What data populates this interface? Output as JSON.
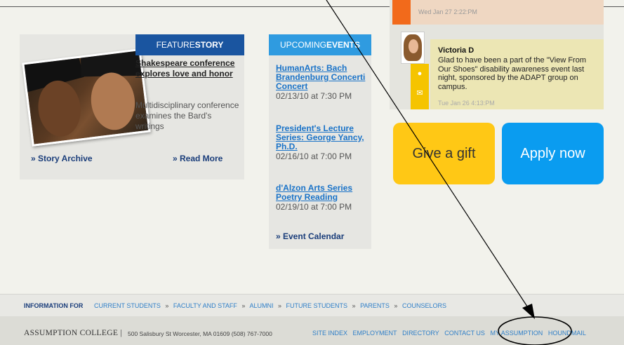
{
  "feature": {
    "head_light": "FEATURE",
    "head_bold": "STORY",
    "title": "Shakespeare conference explores love and honor",
    "description": "Multidisciplinary conference examines the Bard's writings",
    "story_archive": "» Story Archive",
    "read_more": "» Read More"
  },
  "events": {
    "head_light": "UPCOMING",
    "head_bold": "EVENTS",
    "items": [
      {
        "title": "HumanArts: Bach Brandenburg Concerti Concert",
        "date": "02/13/10 at 7:30 PM"
      },
      {
        "title": "President's Lecture Series: George Yancy, Ph.D.",
        "date": "02/16/10 at 7:00 PM"
      },
      {
        "title": "d'Alzon Arts Series Poetry Reading",
        "date": "02/19/10 at 7:00 PM"
      }
    ],
    "calendar_link": "» Event Calendar"
  },
  "feed": {
    "post1_time": "Wed Jan 27 2:22:PM",
    "post2": {
      "name": "Victoria D",
      "text": "Glad to have been a part of the \"View From Our Shoes\" disability awareness event last night, sponsored by the ADAPT group on campus.",
      "time": "Tue Jan 26 4:13:PM"
    }
  },
  "buttons": {
    "gift": "Give a gift",
    "apply": "Apply now"
  },
  "info_bar": {
    "label": "INFORMATION FOR",
    "links": [
      "CURRENT STUDENTS",
      "FACULTY AND STAFF",
      "ALUMNI",
      "FUTURE STUDENTS",
      "PARENTS",
      "COUNSELORS"
    ],
    "separator": "»"
  },
  "bottom_bar": {
    "college": "ASSUMPTION COLLEGE |",
    "address": "500 Salisbury St Worcester, MA 01609 (508) 767-7000",
    "links": [
      "SITE INDEX",
      "EMPLOYMENT",
      "DIRECTORY",
      "CONTACT US",
      "MY ASSUMPTION",
      "HOUNDMAIL"
    ]
  },
  "colors": {
    "feature_blue": "#1a55a0",
    "events_blue": "#2f9be0",
    "gift_yellow": "#ffc815",
    "apply_blue": "#0a9cf0",
    "annotation": "#000000"
  },
  "icons": [
    "comment-icon",
    "mail-icon"
  ]
}
